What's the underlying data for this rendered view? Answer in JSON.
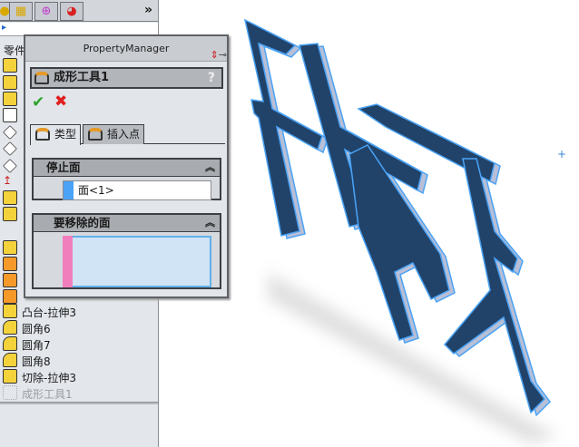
{
  "left_tabs": [
    {
      "icon": "feature-manager-icon"
    },
    {
      "icon": "property-manager-icon"
    },
    {
      "icon": "configuration-manager-icon"
    },
    {
      "icon": "display-manager-icon"
    }
  ],
  "left_more": "»",
  "tree": {
    "root_label": "零件",
    "items": [
      {
        "label": "凸台-拉伸3",
        "icon": "extrude-boss-icon"
      },
      {
        "label": "圆角6",
        "icon": "fillet-icon"
      },
      {
        "label": "圆角7",
        "icon": "fillet-icon"
      },
      {
        "label": "圆角8",
        "icon": "fillet-icon"
      },
      {
        "label": "切除-拉伸3",
        "icon": "extrude-cut-icon"
      },
      {
        "label": "成形工具1",
        "icon": "forming-tool-icon",
        "suppressed": true
      }
    ]
  },
  "property_manager": {
    "title": "PropertyManager",
    "feature_name": "成形工具1",
    "help": "?",
    "ok": "✔",
    "cancel": "✖",
    "tabs": [
      {
        "label": "类型",
        "active": true
      },
      {
        "label": "插入点",
        "active": false
      }
    ],
    "sections": [
      {
        "title": "停止面",
        "collapse": "︽",
        "value": "面<1>",
        "swatch": "#4aa3f6"
      },
      {
        "title": "要移除的面",
        "collapse": "︽",
        "value": "",
        "swatch": "#f07ebd"
      }
    ]
  },
  "colors": {
    "model_face": "#21436a",
    "model_edge": "#4aa3f6",
    "model_side": "#b8bfd6"
  }
}
